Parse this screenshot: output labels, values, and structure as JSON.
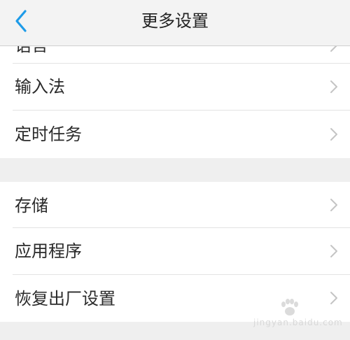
{
  "header": {
    "title": "更多设置",
    "back_icon": "chevron-left-icon",
    "accent_color": "#1e9be8"
  },
  "groups": [
    {
      "items": [
        {
          "label": "语言",
          "icon": "chevron-right-icon"
        },
        {
          "label": "输入法",
          "icon": "chevron-right-icon"
        },
        {
          "label": "定时任务",
          "icon": "chevron-right-icon"
        }
      ]
    },
    {
      "items": [
        {
          "label": "存储",
          "icon": "chevron-right-icon"
        },
        {
          "label": "应用程序",
          "icon": "chevron-right-icon"
        },
        {
          "label": "恢复出厂设置",
          "icon": "chevron-right-icon"
        }
      ]
    }
  ],
  "watermark": {
    "text": "jingyan.baidu.com"
  }
}
